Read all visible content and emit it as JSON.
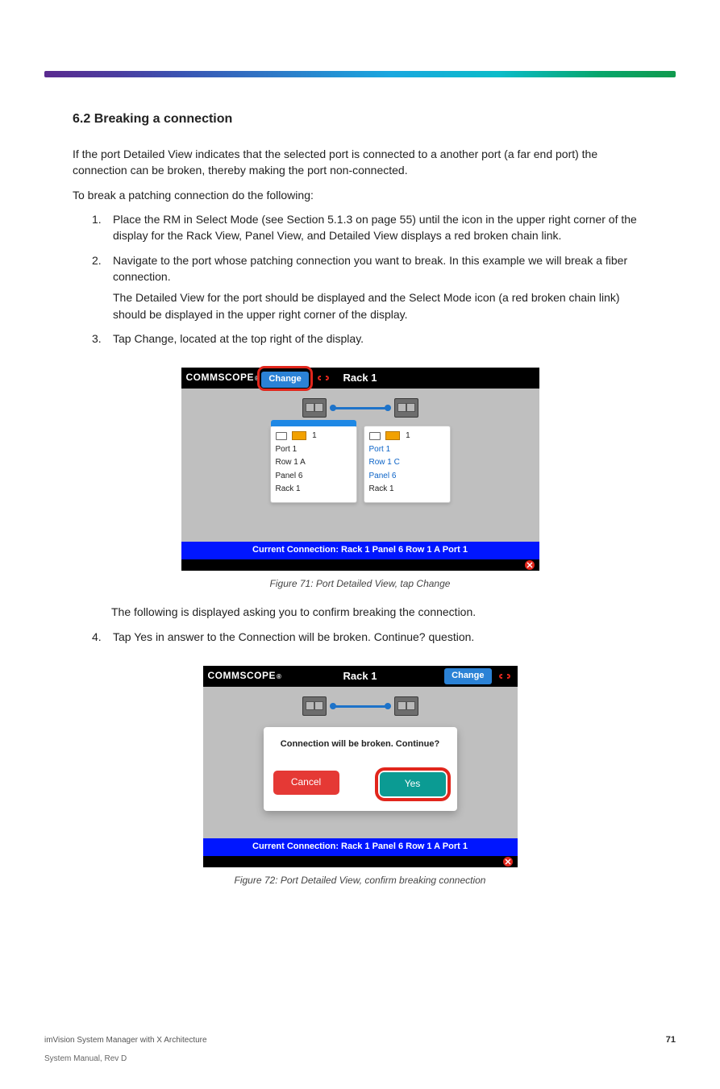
{
  "doc": {
    "title_banner": "",
    "section_title": "6.2 Breaking a connection",
    "intro1": "If the port Detailed View indicates that the selected port is connected to a another port (a far end port) the connection can be broken, thereby making the port non-connected.",
    "intro2": "To break a patching connection do the following:",
    "steps": {
      "s1": {
        "n": "1.",
        "t": "Place the RM in Select Mode (see Section 5.1.3 on page 55) until the icon in the upper right corner of the display for the Rack View, Panel View, and Detailed View displays a red broken chain link."
      },
      "s2": {
        "n": "2.",
        "t": "Navigate to the port whose patching connection you want to break. In this example we will break a fiber connection.",
        "t2": "The Detailed View for the port should be displayed and the Select Mode icon (a red broken chain link) should be displayed in the upper right corner of the display."
      },
      "s3": {
        "n": "3.",
        "t": "Tap Change, located at the top right of the display."
      },
      "s4": {
        "n": "4.",
        "t": "Tap Yes in answer to the Connection will be broken. Continue? question."
      }
    },
    "caption3": "Figure 71: Port Detailed View, tap Change",
    "after3": "The following is displayed asking you to confirm breaking the connection.",
    "caption4": "Figure 72: Port Detailed View, confirm breaking connection"
  },
  "shot1": {
    "brand": "COMMSCOPE",
    "title": "Rack 1",
    "change": "Change",
    "cardA": {
      "num": "1",
      "l1": "Port 1",
      "l2": "Row 1 A",
      "l3": "Panel 6",
      "l4": "Rack 1"
    },
    "cardB": {
      "num": "1",
      "l1": "Port 1",
      "l2": "Row 1 C",
      "l3": "Panel 6",
      "l4": "Rack 1"
    },
    "strip": "Current Connection: Rack 1 Panel 6 Row 1 A Port 1"
  },
  "shot2": {
    "brand": "COMMSCOPE",
    "title": "Rack 1",
    "change": "Change",
    "modal": {
      "q": "Connection will be broken. Continue?",
      "cancel": "Cancel",
      "yes": "Yes"
    },
    "strip": "Current Connection: Rack 1 Panel 6 Row 1 A Port 1"
  },
  "footer": {
    "left": "imVision System Manager with X Architecture",
    "right": "71",
    "rev": "System Manual, Rev D"
  }
}
